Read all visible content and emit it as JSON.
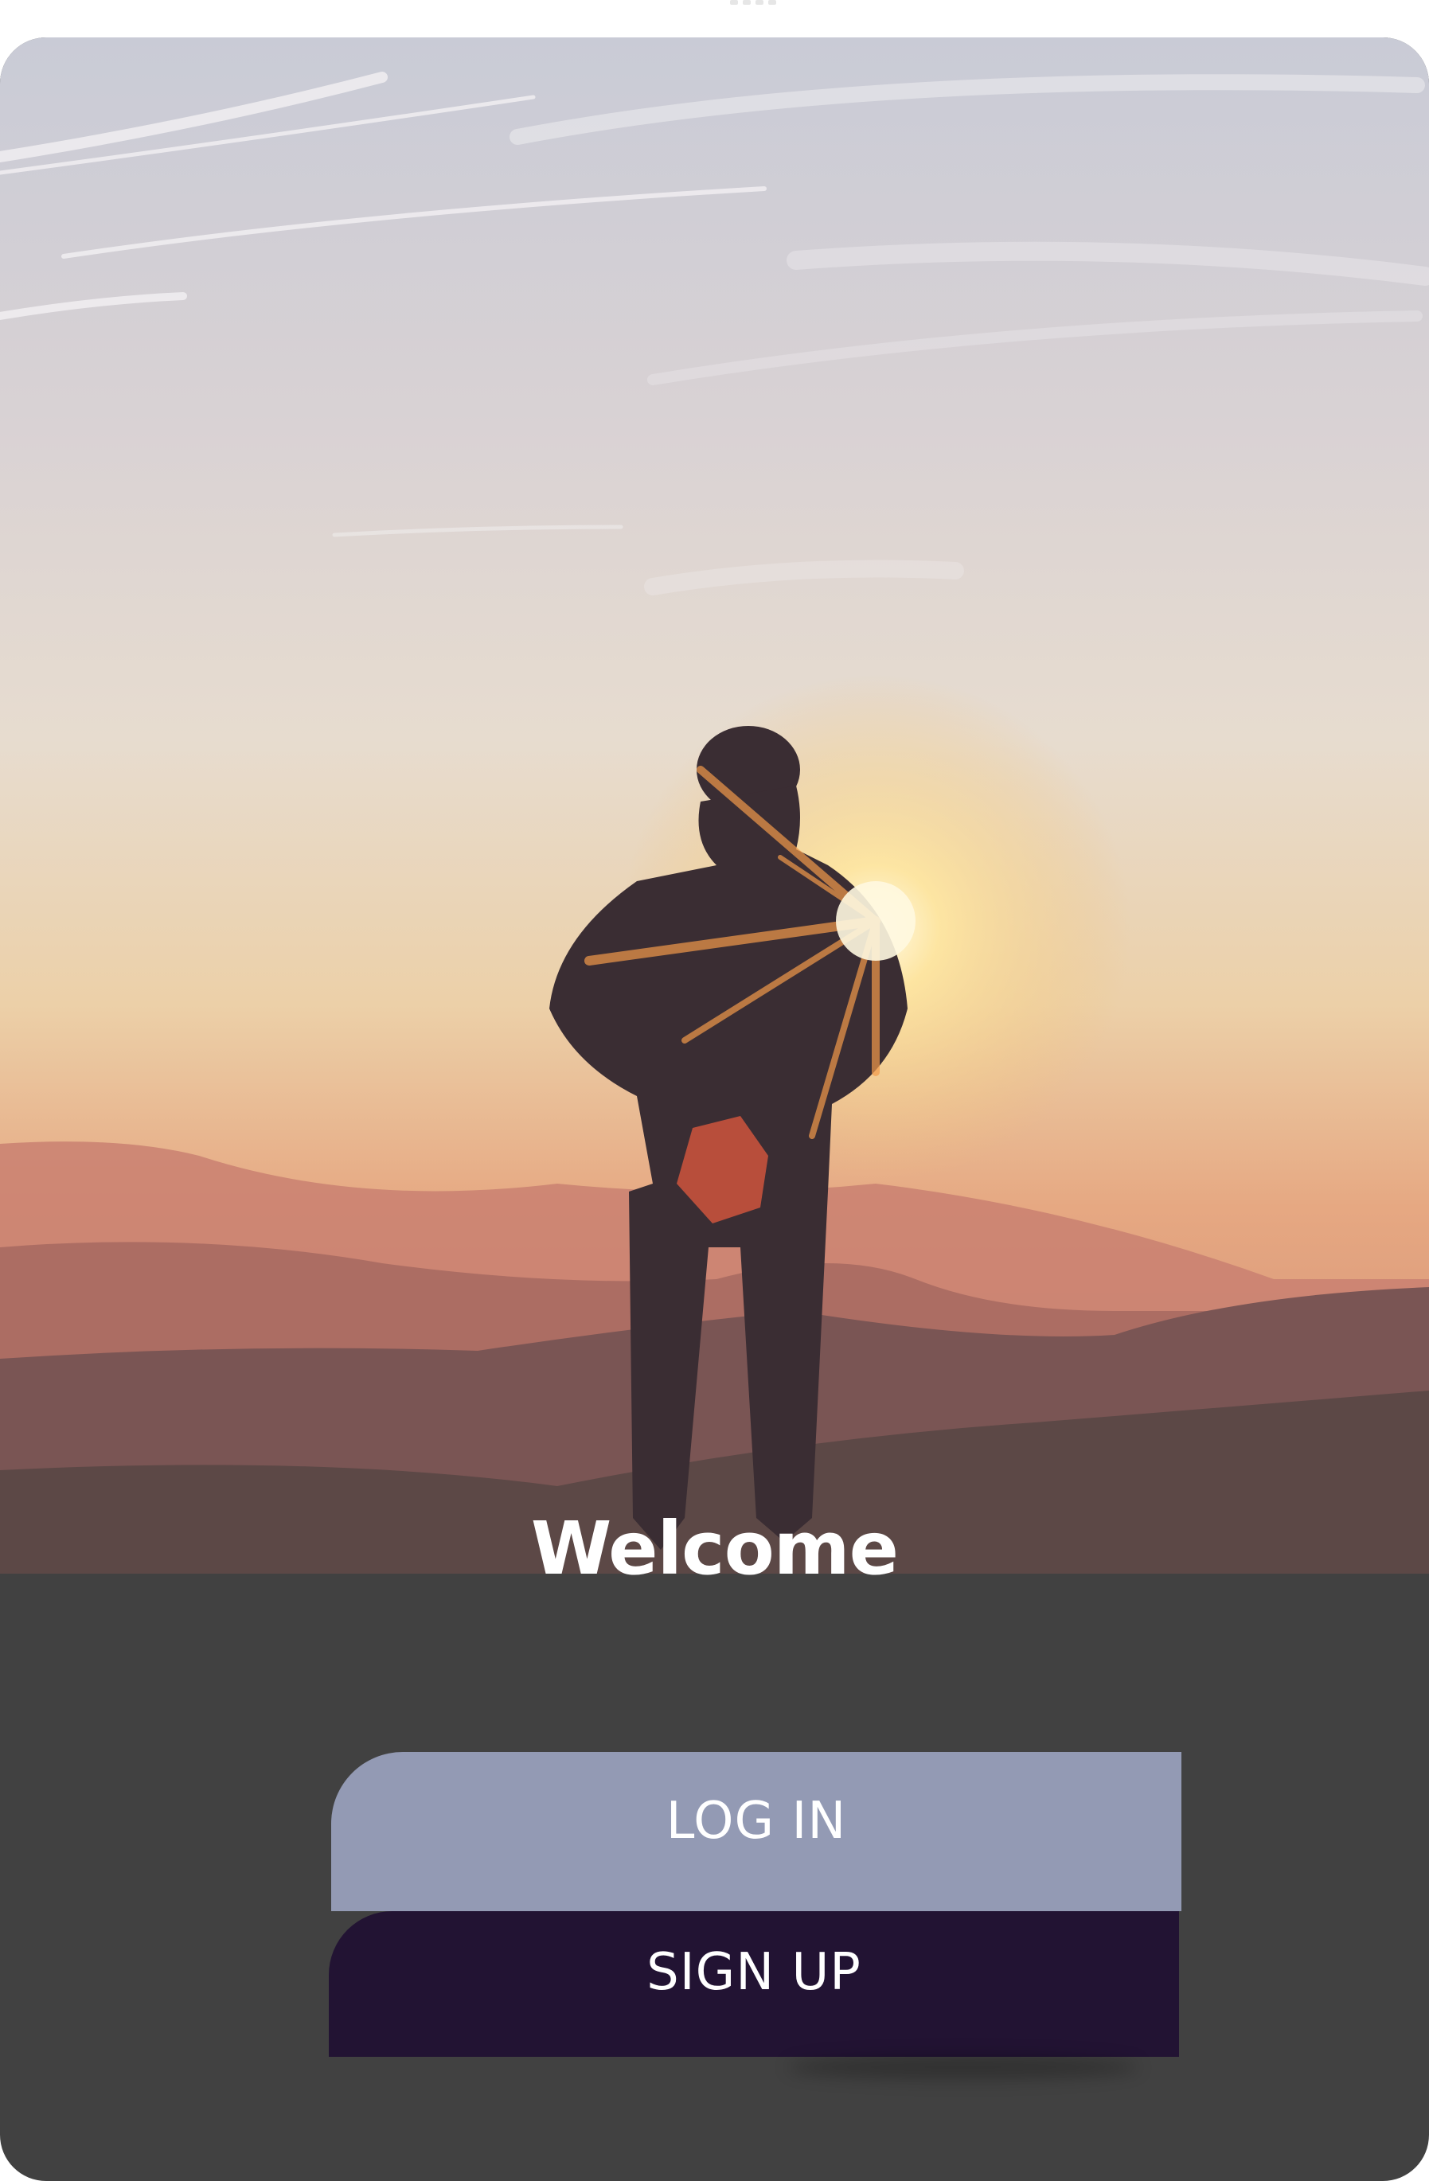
{
  "welcome": {
    "title": "Welcome"
  },
  "actions": {
    "login_label": "LOG IN",
    "signup_label": "SIGN UP"
  },
  "colors": {
    "background": "#414141",
    "login_button": "#939ab4",
    "signup_button": "#221333",
    "text": "#ffffff"
  },
  "hero": {
    "icon": "sunset-hiker-photo"
  }
}
